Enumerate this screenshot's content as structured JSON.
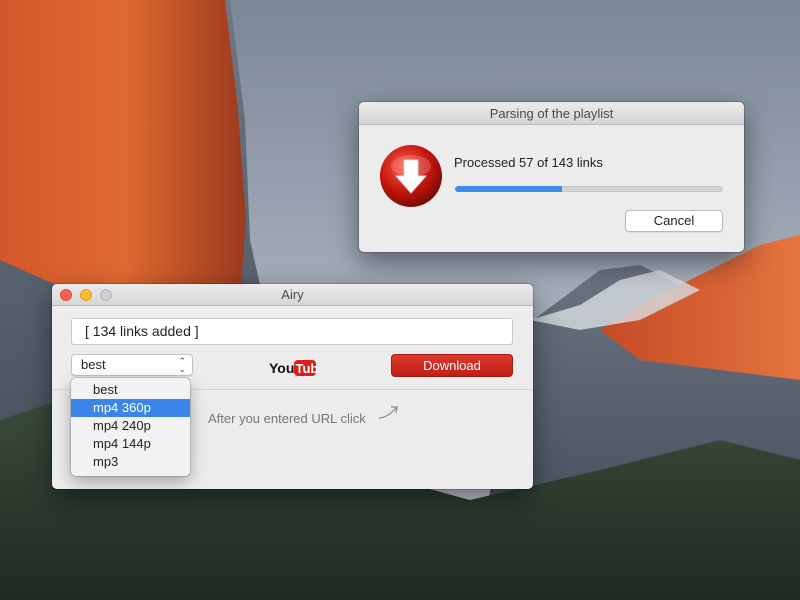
{
  "parse_dialog": {
    "title": "Parsing of the playlist",
    "status_text": "Processed 57 of 143 links",
    "processed": 57,
    "total": 143,
    "progress_fraction": 0.4,
    "cancel_label": "Cancel",
    "icon": "airy-download-icon"
  },
  "airy_window": {
    "title": "Airy",
    "url_value": "[ 134 links added ]",
    "format_selected": "best",
    "brand_logo": {
      "you": "You",
      "tube": "Tube"
    },
    "download_label": "Download",
    "hint": "After you entered URL click"
  },
  "dropdown": {
    "options": [
      "best",
      "mp4 360p",
      "mp4 240p",
      "mp4 144p",
      "mp3"
    ],
    "highlighted_index": 1
  },
  "colors": {
    "progress_blue": "#3d8ee8",
    "download_red": "#c9251a",
    "menu_highlight": "#3b85e8",
    "traffic_close": "#fc5f57",
    "traffic_min": "#fdbc2e"
  }
}
